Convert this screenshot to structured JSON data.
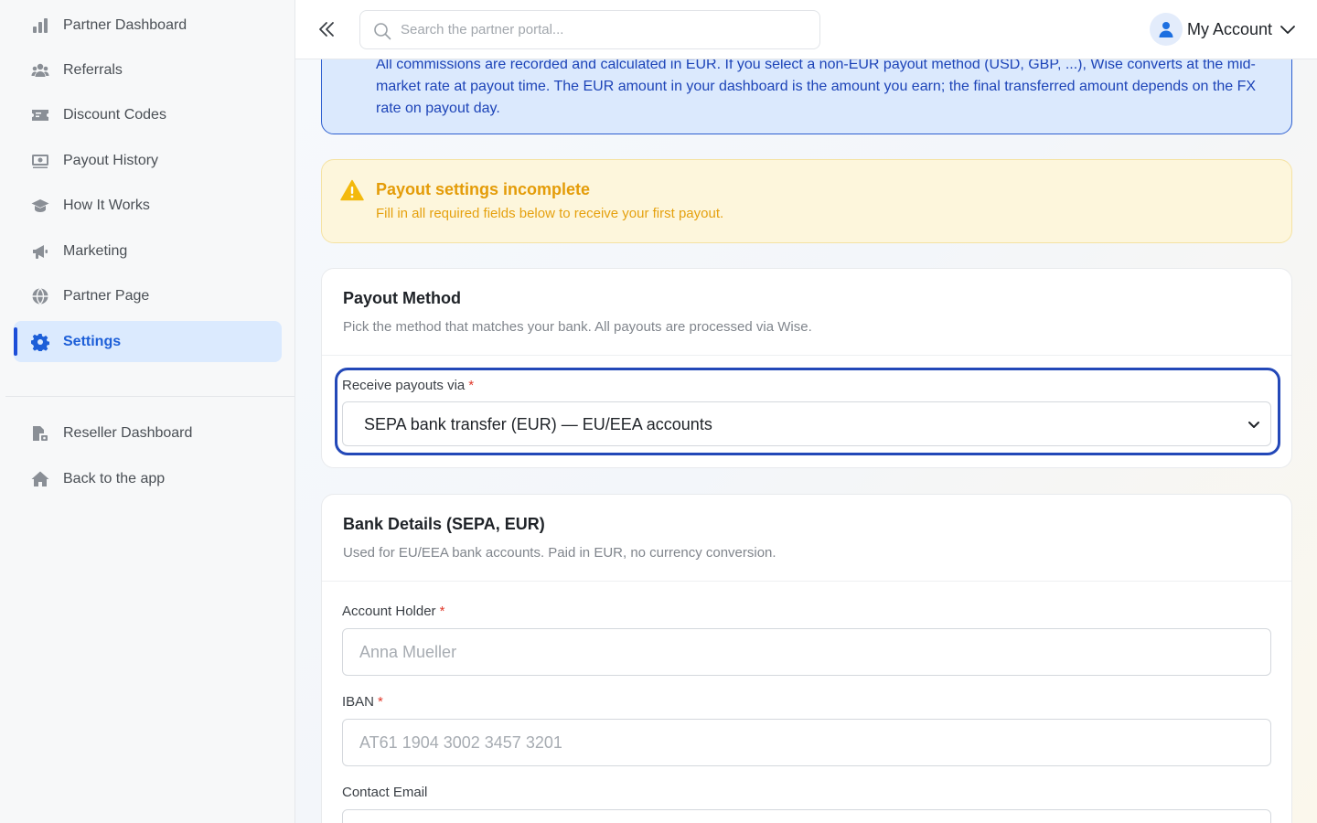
{
  "sidebar": {
    "items": [
      {
        "label": "Partner Dashboard",
        "icon": "bar-chart-icon"
      },
      {
        "label": "Referrals",
        "icon": "users-icon"
      },
      {
        "label": "Discount Codes",
        "icon": "ticket-icon"
      },
      {
        "label": "Payout History",
        "icon": "money-bill-icon"
      },
      {
        "label": "How It Works",
        "icon": "graduation-cap-icon"
      },
      {
        "label": "Marketing",
        "icon": "megaphone-icon"
      },
      {
        "label": "Partner Page",
        "icon": "globe-icon"
      },
      {
        "label": "Settings",
        "icon": "gear-icon",
        "active": true
      }
    ],
    "secondary": [
      {
        "label": "Reseller Dashboard",
        "icon": "reseller-icon"
      },
      {
        "label": "Back to the app",
        "icon": "home-icon"
      }
    ]
  },
  "header": {
    "search_placeholder": "Search the partner portal...",
    "account_label": "My Account"
  },
  "info_banner": {
    "text": "All commissions are recorded and calculated in EUR. If you select a non-EUR payout method (USD, GBP, ...), Wise converts at the mid-market rate at payout time. The EUR amount in your dashboard is the amount you earn; the final transferred amount depends on the FX rate on payout day."
  },
  "warning_banner": {
    "title": "Payout settings incomplete",
    "text": "Fill in all required fields below to receive your first payout."
  },
  "payout_method": {
    "title": "Payout Method",
    "subtitle": "Pick the method that matches your bank. All payouts are processed via Wise.",
    "field_label": "Receive payouts via",
    "required_mark": "*",
    "selected": "SEPA bank transfer (EUR) — EU/EEA accounts"
  },
  "bank_details": {
    "title": "Bank Details (SEPA, EUR)",
    "subtitle": "Used for EU/EEA bank accounts. Paid in EUR, no currency conversion.",
    "account_holder": {
      "label": "Account Holder",
      "required_mark": "*",
      "placeholder": "Anna Mueller",
      "value": ""
    },
    "iban": {
      "label": "IBAN",
      "required_mark": "*",
      "placeholder": "AT61 1904 3002 3457 3201",
      "value": ""
    },
    "contact_email": {
      "label": "Contact Email"
    }
  },
  "colors": {
    "accent": "#1d4ed8",
    "info_bg": "#dbe9fd",
    "warning_text": "#e49c08",
    "required": "#e0392b"
  }
}
